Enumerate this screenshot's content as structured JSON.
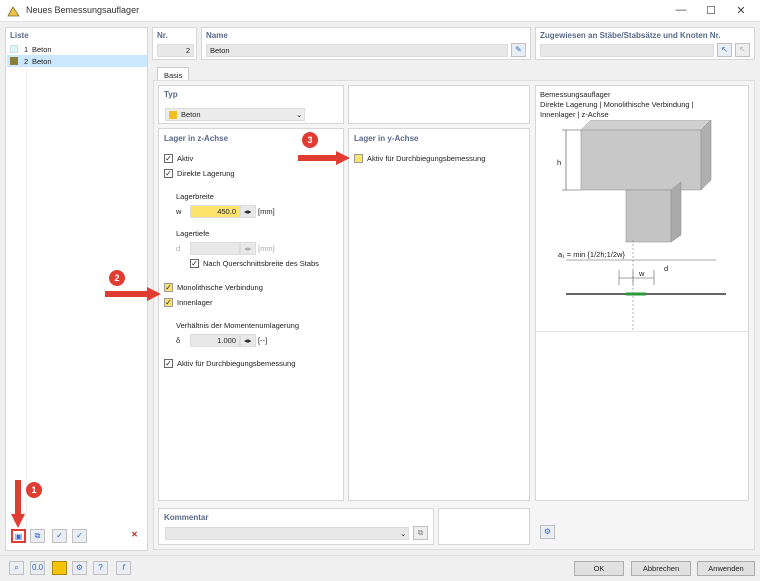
{
  "window": {
    "title": "Neues Bemessungsauflager",
    "min": "—",
    "max": "☐",
    "close": "✕"
  },
  "list": {
    "header": "Liste",
    "items": [
      {
        "num": "1",
        "label": "Beton",
        "color": "#e0f4f8"
      },
      {
        "num": "2",
        "label": "Beton",
        "color": "#8a7d3a"
      }
    ]
  },
  "nr": {
    "label": "Nr.",
    "value": "2"
  },
  "name": {
    "label": "Name",
    "value": "Beton"
  },
  "assigned": {
    "label": "Zugewiesen an Stäbe/Stabsätze und Knoten Nr."
  },
  "tab": {
    "label": "Basis"
  },
  "typ": {
    "title": "Typ",
    "value": "Beton",
    "color": "#f0c020"
  },
  "z": {
    "title": "Lager in z-Achse",
    "aktiv": "Aktiv",
    "direkt": "Direkte Lagerung",
    "lagerbreite": "Lagerbreite",
    "w_sym": "w",
    "w_value": "450.0",
    "w_unit": "[mm]",
    "lagertiefe": "Lagertiefe",
    "d_sym": "d",
    "d_unit": "[mm]",
    "quer": "Nach Querschnittsbreite des Stabs",
    "mono": "Monolithische Verbindung",
    "innen": "Innenlager",
    "verh": "Verhältnis der Momentenumlagerung",
    "delta_sym": "δ",
    "delta_value": "1.000",
    "delta_unit": "[--]",
    "durch": "Aktiv für Durchbiegungsbemessung"
  },
  "y": {
    "title": "Lager in y-Achse",
    "durch": "Aktiv für Durchbiegungsbemessung"
  },
  "diagram": {
    "line1": "Bemessungsauflager",
    "line2": "Direkte Lagerung | Monolithische Verbindung |",
    "line3": "Innenlager | z-Achse",
    "h": "h",
    "formula": "a₁ = min {1/2h;1/2w}",
    "w": "w",
    "d": "d"
  },
  "kommentar": {
    "title": "Kommentar"
  },
  "badges": {
    "b1": "1",
    "b2": "2",
    "b3": "3"
  },
  "buttons": {
    "ok": "OK",
    "cancel": "Abbrechen",
    "apply": "Anwenden"
  },
  "colors": {
    "accent": "#5a6a8a",
    "highlight": "#fce36b",
    "arrow": "#e03c31",
    "select": "#cce8ff"
  }
}
